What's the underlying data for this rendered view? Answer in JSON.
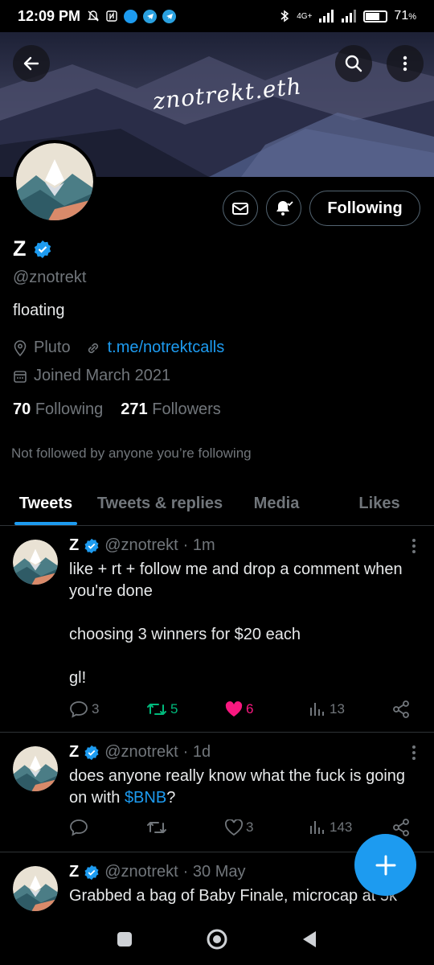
{
  "status_bar": {
    "time": "12:09 PM",
    "network": "4G+",
    "battery": "71",
    "battery_pct_symbol": "%",
    "battery_level": 0.71
  },
  "banner": {
    "text": "znotrekt.eth",
    "back_icon": "back-arrow-icon",
    "search_icon": "search-icon",
    "more_icon": "more-vertical-icon"
  },
  "profile": {
    "name": "Z",
    "handle": "@znotrekt",
    "bio": "floating",
    "location": "Pluto",
    "website": "t.me/notrektcalls",
    "joined": "Joined March 2021",
    "following_count": "70",
    "following_label": "Following",
    "followers_count": "271",
    "followers_label": "Followers",
    "not_followed_note": "Not followed by anyone you’re following",
    "follow_button": "Following"
  },
  "tabs": [
    {
      "label": "Tweets",
      "active": true
    },
    {
      "label": "Tweets & replies",
      "active": false
    },
    {
      "label": "Media",
      "active": false
    },
    {
      "label": "Likes",
      "active": false
    }
  ],
  "tweets": [
    {
      "name": "Z",
      "handle": "@znotrekt",
      "time": "· 1m",
      "body": "like + rt + follow me and drop a comment when you're done\n\nchoosing 3 winners for $20 each\n\ngl!",
      "replies": "3",
      "retweets": "5",
      "likes": "6",
      "views": "13"
    },
    {
      "name": "Z",
      "handle": "@znotrekt",
      "time": "· 1d",
      "body_prefix": "does anyone really know what the fuck is going on with ",
      "cashtag": "$BNB",
      "body_suffix": "?",
      "replies": "",
      "retweets": "",
      "likes": "3",
      "views": "143"
    },
    {
      "name": "Z",
      "handle": "@znotrekt",
      "time": "· 30 May",
      "body": "Grabbed a bag of Baby Finale, microcap at 5k"
    }
  ],
  "colors": {
    "accent": "#1d9bf0",
    "like": "#f91880",
    "retweet": "#00ba7c",
    "muted": "#71767b"
  }
}
